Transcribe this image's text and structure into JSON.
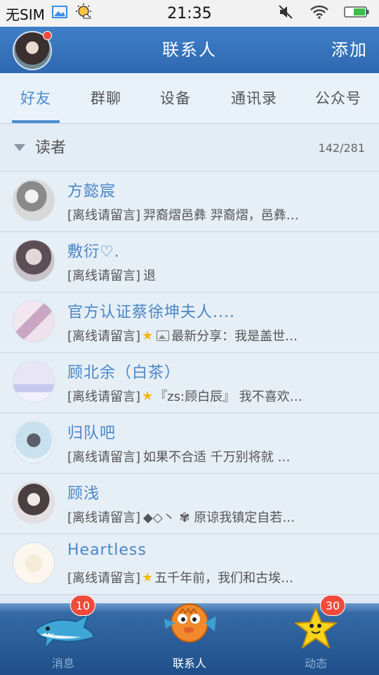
{
  "status_bar": {
    "carrier": "无SIM",
    "time": "21:35"
  },
  "header": {
    "title": "联系人",
    "add_label": "添加"
  },
  "tabs": [
    {
      "label": "好友",
      "active": true
    },
    {
      "label": "群聊",
      "active": false
    },
    {
      "label": "设备",
      "active": false
    },
    {
      "label": "通讯录",
      "active": false
    },
    {
      "label": "公众号",
      "active": false
    }
  ],
  "group": {
    "name": "读者",
    "count": "142/281"
  },
  "contacts": [
    {
      "name": "方懿宸",
      "status": "[离线请留言]",
      "message": "羿裔熠邑彝 羿裔熠，邑彝…"
    },
    {
      "name": "敷衍♡.",
      "status": "[离线请留言]",
      "message": "退"
    },
    {
      "name": "官方认证蔡徐坤夫人....",
      "status": "[离线请留言]",
      "message": "最新分享：我是盖世…"
    },
    {
      "name": "顾北余（白茶）",
      "status": "[离线请留言]",
      "message": "『zs:顾白辰』 我不喜欢…"
    },
    {
      "name": "归队吧",
      "status": "[离线请留言]",
      "message": "如果不合适 千万别将就 …"
    },
    {
      "name": "顾浅",
      "status": "[离线请留言]",
      "message": "◆◇丶 ✾ 原谅我镇定自若…"
    },
    {
      "name": "Heartless",
      "status": "[离线请留言]",
      "message": "五千年前，我们和古埃…"
    }
  ],
  "bottom_nav": [
    {
      "label": "消息",
      "badge": "10",
      "icon": "shark-icon"
    },
    {
      "label": "联系人",
      "badge": "",
      "icon": "fish-icon"
    },
    {
      "label": "动态",
      "badge": "30",
      "icon": "starfish-icon"
    }
  ],
  "colors": {
    "header": "#3574bd",
    "accent": "#4a8cd0",
    "badge": "#f04a3b",
    "star": "#f5b800"
  }
}
